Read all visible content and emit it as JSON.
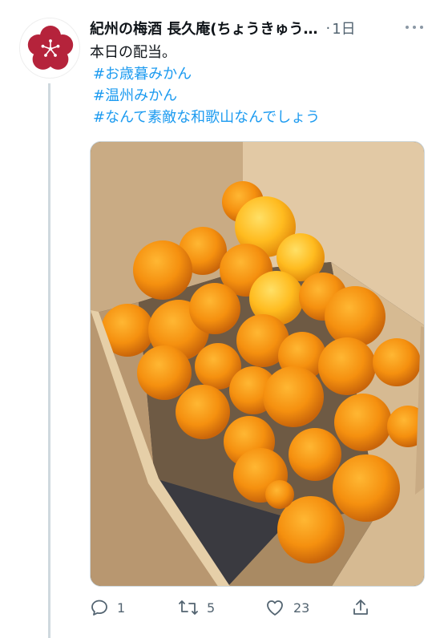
{
  "account": {
    "display_name": "紀州の梅酒 長久庵(ちょうきゅう…",
    "timestamp": "1日",
    "avatar_icon": "plum-blossom-icon"
  },
  "tweet": {
    "line1": "本日の配当。",
    "hashtags": [
      "#お歳暮みかん",
      "#温州みかん",
      "#なんて素敵な和歌山なんでしょう"
    ]
  },
  "media": {
    "alt": "Cardboard box full of mandarin oranges"
  },
  "actions": {
    "reply_count": "1",
    "retweet_count": "5",
    "like_count": "23"
  },
  "colors": {
    "accent": "#1d9bf0",
    "muted": "#536471",
    "avatar_red": "#b5233b"
  }
}
